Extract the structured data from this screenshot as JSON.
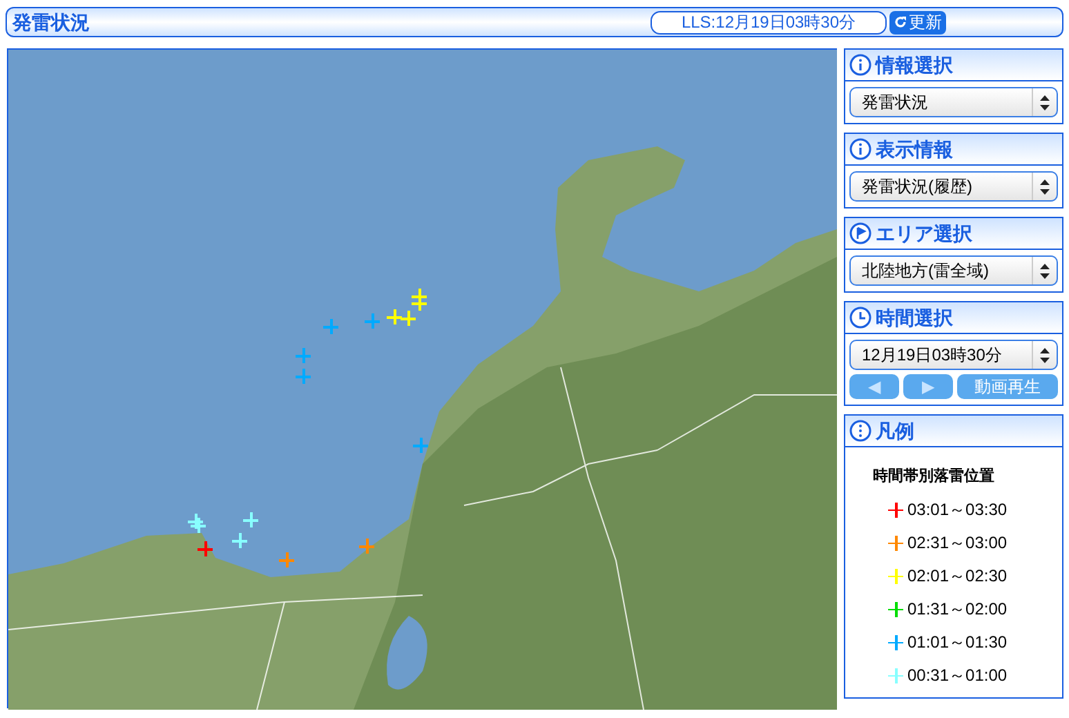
{
  "header": {
    "title": "発雷状況",
    "timestamp": "LLS:12月19日03時30分",
    "refresh_button": "更新"
  },
  "map": {
    "strikes": [
      {
        "color": "#ffff00"
      },
      {
        "color": "#ffff00"
      },
      {
        "color": "#ffff00"
      },
      {
        "color": "#ffff00"
      },
      {
        "color": "#00aaff"
      },
      {
        "color": "#00aaff"
      },
      {
        "color": "#00aaff"
      },
      {
        "color": "#00aaff"
      },
      {
        "color": "#00aaff"
      },
      {
        "color": "#88ffff"
      },
      {
        "color": "#88ffff"
      },
      {
        "color": "#88ffff"
      },
      {
        "color": "#88ffff"
      },
      {
        "color": "#ff0000"
      },
      {
        "color": "#ff8800"
      },
      {
        "color": "#ff8800"
      }
    ]
  },
  "sidebar": {
    "panels": [
      {
        "kind": "select",
        "title": "情報選択",
        "value": "発雷状況"
      },
      {
        "kind": "select",
        "title": "表示情報",
        "value": "発雷状況(履歴)"
      },
      {
        "kind": "select",
        "title": "エリア選択",
        "value": "北陸地方(雷全域)"
      },
      {
        "kind": "time",
        "title": "時間選択",
        "value": "12月19日03時30分",
        "prev": "◀",
        "next": "▶",
        "play": "動画再生"
      },
      {
        "kind": "legend",
        "title": "凡例",
        "subtitle": "時間帯別落雷位置",
        "items": [
          {
            "label": "03:01～03:30",
            "color": "#ff0000"
          },
          {
            "label": "02:31～03:00",
            "color": "#ff8800"
          },
          {
            "label": "02:01～02:30",
            "color": "#ffff00"
          },
          {
            "label": "01:31～02:00",
            "color": "#00dd00"
          },
          {
            "label": "01:01～01:30",
            "color": "#00aaff"
          },
          {
            "label": "00:31～01:00",
            "color": "#88ffff"
          }
        ]
      }
    ]
  }
}
